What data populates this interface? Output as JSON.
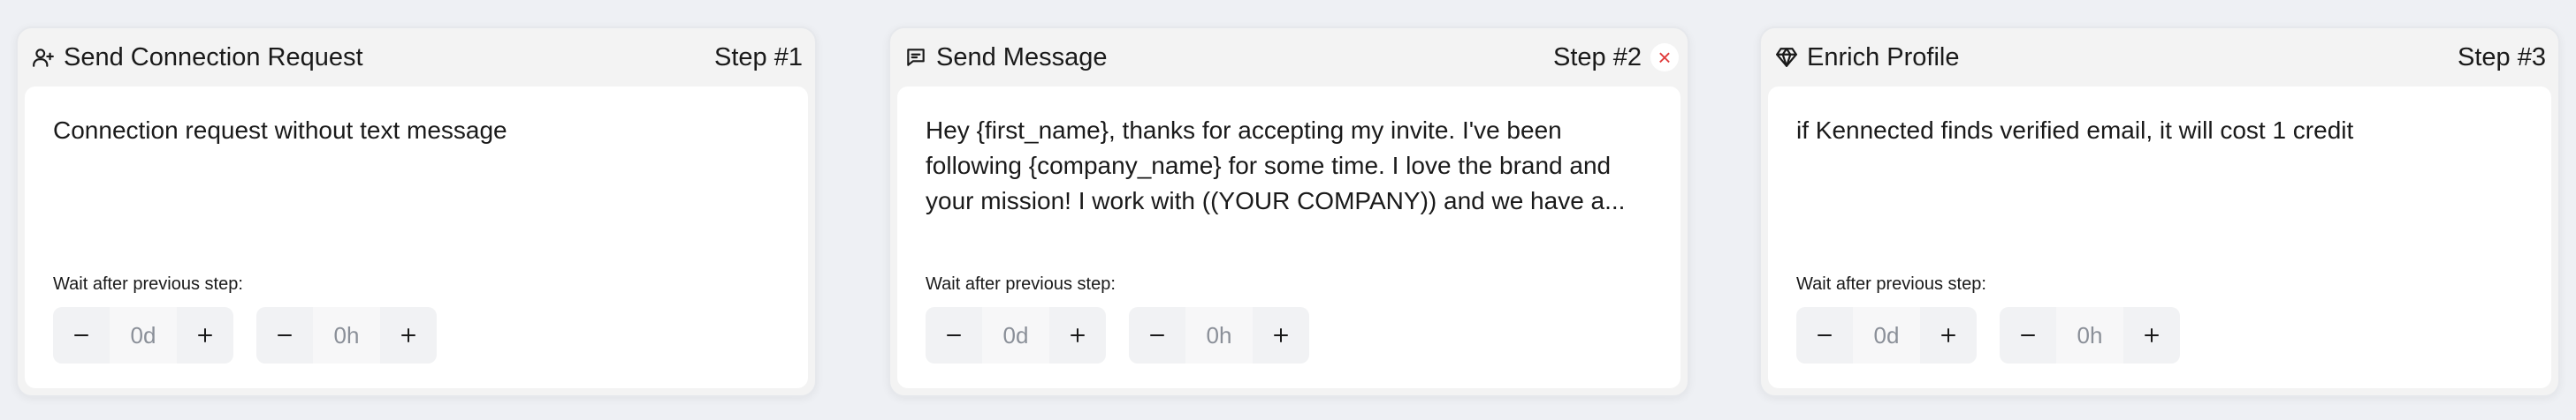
{
  "steps": [
    {
      "title": "Send Connection Request",
      "icon": "user-plus-icon",
      "step_label": "Step #1",
      "message": "Connection request without text message",
      "wait_label": "Wait after previous step:",
      "days_placeholder": "0d",
      "hours_placeholder": "0h"
    },
    {
      "title": "Send Message",
      "icon": "message-icon",
      "step_label": "Step #2",
      "close_symbol": "×",
      "message": "Hey {first_name}, thanks for accepting my invite. I've been following {company_name} for some time. I love the brand and your mission! I work with ((YOUR COMPANY)) and we have a...",
      "wait_label": "Wait after previous step:",
      "days_placeholder": "0d",
      "hours_placeholder": "0h"
    },
    {
      "title": "Enrich Profile",
      "icon": "gem-icon",
      "step_label": "Step #3",
      "message": "if Kennected finds verified email, it will cost 1 credit",
      "wait_label": "Wait after previous step:",
      "days_placeholder": "0d",
      "hours_placeholder": "0h"
    }
  ],
  "colors": {
    "page_bg": "#eef0f4",
    "card_header_bg": "#f3f3f3",
    "card_body_bg": "#ffffff",
    "stepper_bg": "#f1f2f4",
    "close_red": "#e03b3b",
    "placeholder_gray": "#8a8f98"
  }
}
